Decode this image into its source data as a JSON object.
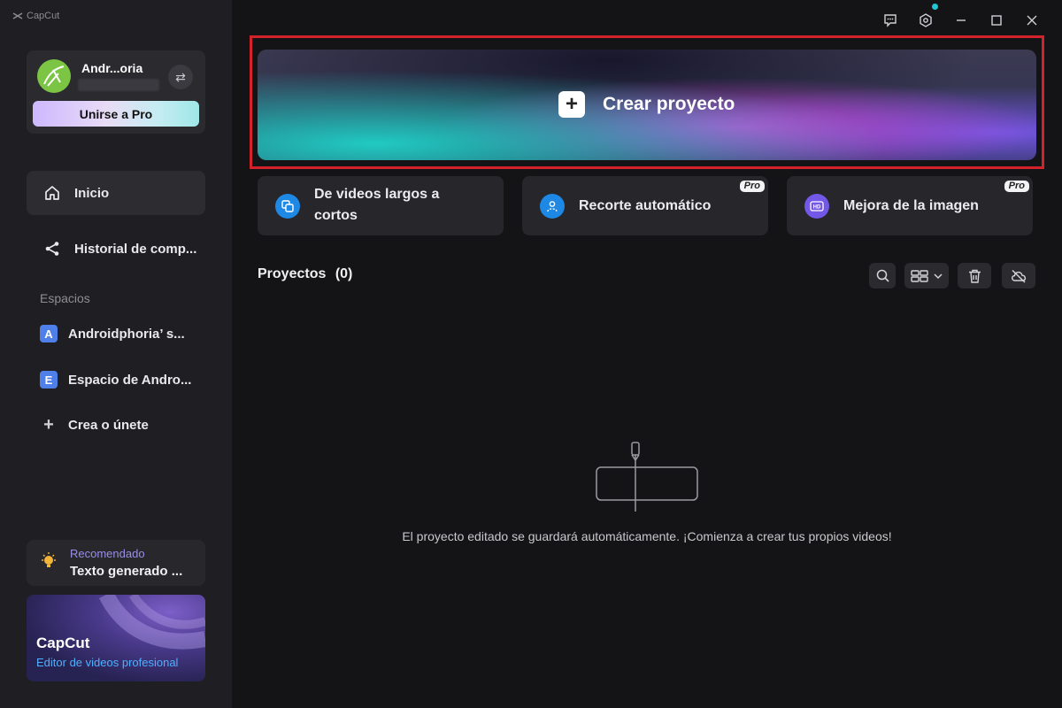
{
  "app": {
    "title": "CapCut"
  },
  "user": {
    "name": "Andr...oria",
    "pro_label": "Unirse a Pro"
  },
  "nav": [
    {
      "label": "Inicio",
      "active": true
    },
    {
      "label": "Historial de comp..."
    }
  ],
  "spaces": {
    "heading": "Espacios",
    "items": [
      {
        "badge": "A",
        "label": "Androidphoria’ s..."
      },
      {
        "badge": "E",
        "label": "Espacio de Andro..."
      }
    ],
    "create_label": "Crea o únete"
  },
  "recommended": {
    "label": "Recomendado",
    "text": "Texto generado ..."
  },
  "promo": {
    "title": "CapCut",
    "subtitle": "Editor de videos profesional"
  },
  "hero": {
    "label": "Crear proyecto"
  },
  "tools": [
    {
      "label": "De videos largos a cortos",
      "pro": false
    },
    {
      "label": "Recorte automático",
      "pro": true
    },
    {
      "label": "Mejora de la imagen",
      "pro": true
    }
  ],
  "pro_tag": "Pro",
  "projects": {
    "title": "Proyectos",
    "count": "(0)"
  },
  "empty_state": {
    "text": "El proyecto editado se guardará automáticamente. ¡Comienza a crear tus propios videos!"
  },
  "colors": {
    "accent_highlight": "#d4222c",
    "space_badge": "#4f7fe8",
    "notification_dot": "#1fc7d4"
  },
  "icons": [
    "capcut-logo-icon",
    "swap-icon",
    "home-icon",
    "share-icon",
    "plus-icon",
    "bulb-icon",
    "feedback-icon",
    "settings-icon",
    "minimize-icon",
    "maximize-icon",
    "close-icon",
    "search-icon",
    "grid-view-icon",
    "trash-icon",
    "cloud-off-icon"
  ]
}
